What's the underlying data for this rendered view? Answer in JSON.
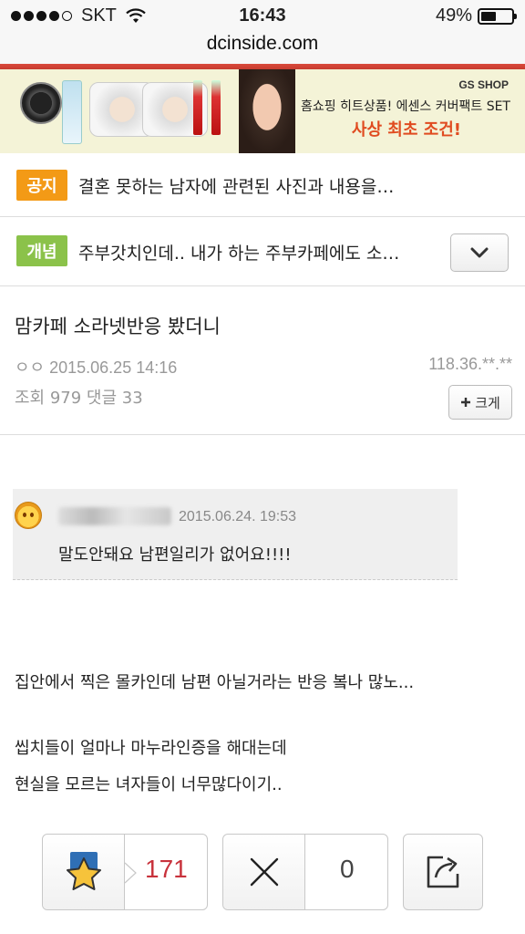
{
  "status_bar": {
    "carrier": "SKT",
    "time": "16:43",
    "battery": "49%",
    "battery_level": 0.49
  },
  "browser": {
    "url": "dcinside.com"
  },
  "ad": {
    "brand": "GS SHOP",
    "line1": "홈쇼핑 히트상품! 에센스 커버팩트 SET",
    "line2": "사상 최초 조건!"
  },
  "notices": [
    {
      "tag": "공지",
      "tag_color": "#f39a16",
      "text": "결혼 못하는 남자에 관련된 사진과 내용을…"
    },
    {
      "tag": "개념",
      "tag_color": "#8bc24a",
      "text": "주부갓치인데.. 내가 하는 주부카페에도 소…"
    }
  ],
  "post": {
    "title": "맘카페 소라넷반응 봤더니",
    "author_date": "ㅇㅇ 2015.06.25 14:16",
    "ip": "118.36.**.**",
    "stats": "조회 979 댓글 33",
    "enlarge_label": "크게"
  },
  "quote": {
    "date": "2015.06.24. 19:53",
    "text": "말도안돼요 남편일리가 없어요!!!!"
  },
  "body": {
    "line1": "집안에서 찍은 몰카인데 남편 아닐거라는 반응 봌나 많노...",
    "line2": "씹치들이 얼마나 마누라인증을 해대는데",
    "line3": "현실을 모르는 녀자들이 너무많다이기.."
  },
  "votes": {
    "up_count": "171",
    "down_count": "0"
  },
  "colors": {
    "accent_red": "#c8323c",
    "notice_orange": "#f39a16",
    "notice_green": "#8bc24a"
  }
}
